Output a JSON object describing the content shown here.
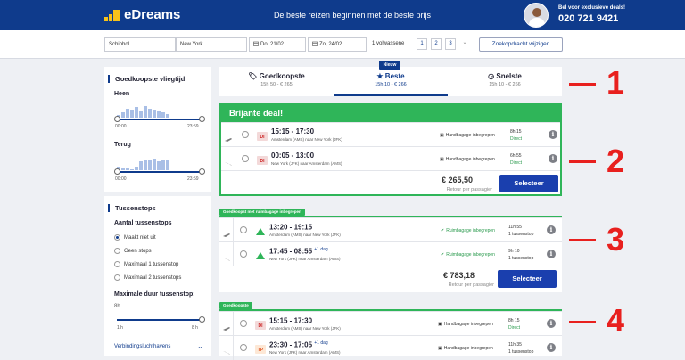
{
  "header": {
    "brand": "eDreams",
    "tagline": "De beste reizen beginnen met de beste prijs",
    "call_cta": "Bel voor exclusieve deals!",
    "phone": "020 721 9421"
  },
  "search": {
    "origin": "Schiphol",
    "destination": "New York",
    "depart": "Do, 21/02",
    "return": "Zo, 24/02",
    "passengers": "1 volwassene",
    "pages": [
      "1",
      "2",
      "3"
    ],
    "modify_label": "Zoekopdracht wijzigen"
  },
  "sidebar": {
    "cheapest_title": "Goedkoopste vliegtijd",
    "outbound_label": "Heen",
    "return_label": "Terug",
    "time_start": "00:00",
    "time_end": "23:59",
    "outbound_hist": [
      2,
      4,
      7,
      6,
      8,
      5,
      9,
      7,
      6,
      5,
      4,
      3
    ],
    "return_hist": [
      3,
      2,
      2,
      1,
      3,
      7,
      8,
      8,
      9,
      7,
      8,
      8
    ],
    "stops_title": "Tussenstops",
    "stops_count_label": "Aantal tussenstops",
    "stops_options": [
      "Maakt niet uit",
      "Geen stops",
      "Maximaal 1 tussenstop",
      "Maximaal 2 tussenstops"
    ],
    "stops_selected_index": 0,
    "duration_label": "Maximale duur tussenstop:",
    "duration_value": "8h",
    "duration_min": "1 h",
    "duration_max": "8 h",
    "connection_airports": "Verbindingsluchthavens"
  },
  "tabs": [
    {
      "label": "Goedkoopste",
      "sub": "15h 50 - € 265",
      "icon": "tag-icon"
    },
    {
      "label": "Beste",
      "sub": "15h 10 - € 266",
      "icon": "star-icon",
      "badge": "Nieuw"
    },
    {
      "label": "Snelste",
      "sub": "15h 10 - € 266",
      "icon": "clock-icon"
    }
  ],
  "deal": {
    "title": "Brijante deal!",
    "title_note": "as printed",
    "price": "€ 265,50",
    "per_passenger": "Retour per passagier",
    "select_label": "Selecteer",
    "flights": [
      {
        "time": "15:15 - 17:30",
        "route": "Amsterdam (AMS) naar New York (JFK)",
        "baggage": "Handbagage inbegrepen",
        "duration": "8h 15",
        "stops": "Direct"
      },
      {
        "time": "00:05 - 13:00",
        "route": "New York (JFK) naar Amsterdam (AMS)",
        "baggage": "Handbagage inbegrepen",
        "duration": "6h 55",
        "stops": "Direct"
      }
    ]
  },
  "cheapest_hold": {
    "tag": "Goedkoopst met ruimbagage inbegrepen",
    "price": "€ 783,18",
    "per_passenger": "Retour per passagier",
    "select_label": "Selecteer",
    "flights": [
      {
        "time": "13:20 - 19:15",
        "plus": "",
        "route": "Amsterdam (AMS) naar New York (JFK)",
        "baggage": "Ruimbagage inbegrepen",
        "duration": "11h 55",
        "stops": "1 tussenstop"
      },
      {
        "time": "17:45 - 08:55",
        "plus": "+1 dag",
        "route": "New York (JFK) naar Amsterdam (AMS)",
        "baggage": "Ruimbagage inbegrepen",
        "duration": "9h 10",
        "stops": "1 tussenstop"
      }
    ]
  },
  "cheapest": {
    "tag": "Goedkoopste",
    "flights": [
      {
        "time": "15:15 - 17:30",
        "plus": "",
        "route": "Amsterdam (AMS) naar New York (JFK)",
        "baggage": "Handbagage inbegrepen",
        "duration": "8h 15",
        "stops": "Direct"
      },
      {
        "time": "23:30 - 17:05",
        "plus": "+1 dag",
        "route": "New York (JFK) naar Amsterdam (AMS)",
        "baggage": "Handbagage inbegrepen",
        "duration": "11h 35",
        "stops": "1 tussenstop"
      }
    ]
  },
  "annotations": [
    "1",
    "2",
    "3",
    "4"
  ],
  "colors": {
    "brand_blue": "#0f3b8c",
    "deal_green": "#2fb559",
    "annotation_red": "#e8201e",
    "logo_yellow": "#f7c21a"
  }
}
